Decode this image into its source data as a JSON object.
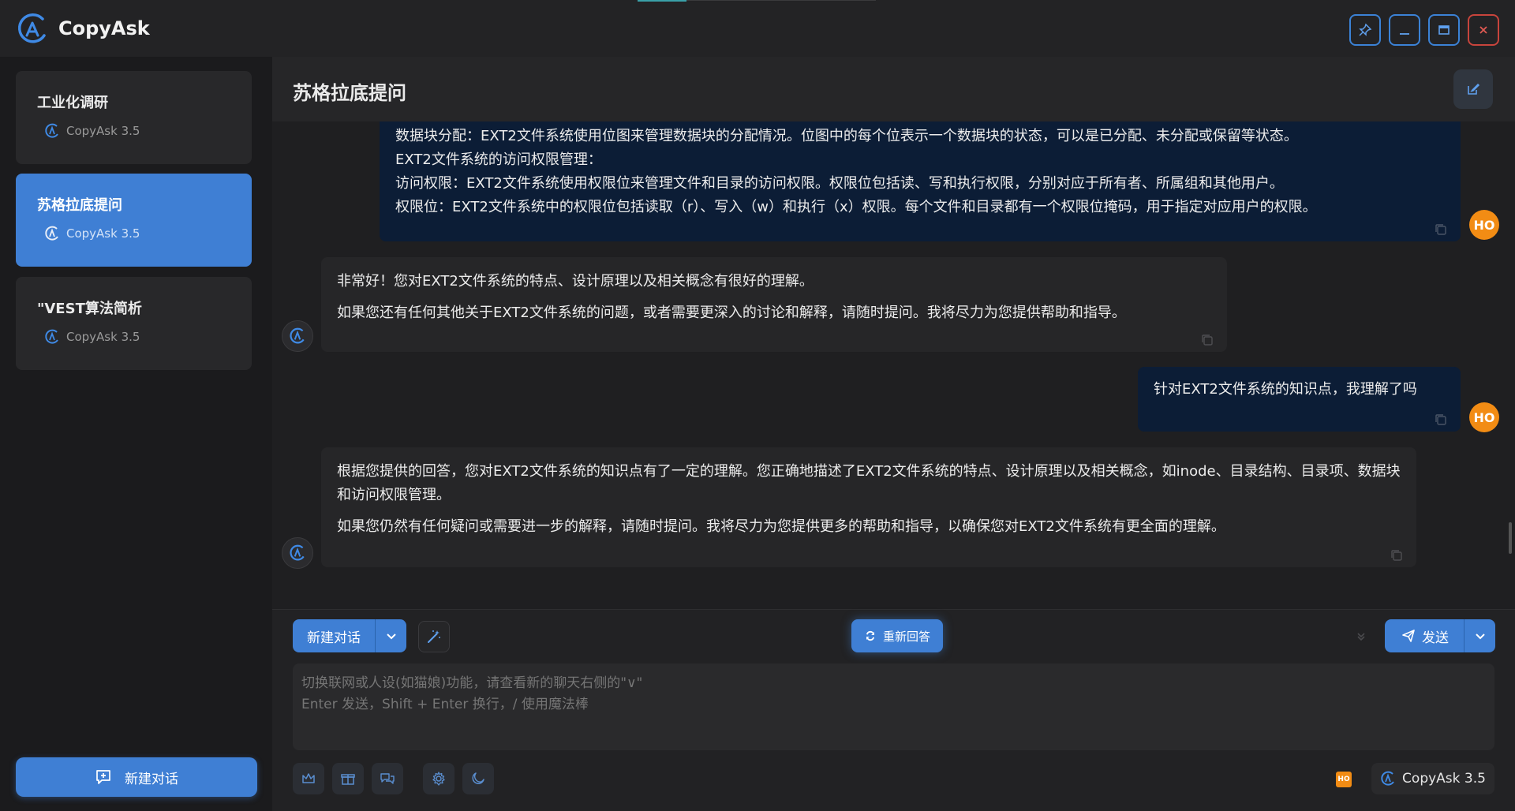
{
  "app": {
    "title": "CopyAsk"
  },
  "window_controls": {
    "pin": "pin",
    "minimize": "minimize",
    "maximize": "maximize",
    "close": "close"
  },
  "sidebar": {
    "conversations": [
      {
        "title": "工业化调研",
        "model": "CopyAsk 3.5",
        "active": false
      },
      {
        "title": "苏格拉底提问",
        "model": "CopyAsk 3.5",
        "active": true
      },
      {
        "title": "\"VEST算法简析",
        "model": "CopyAsk 3.5",
        "active": false
      }
    ],
    "new_conversation_label": "新建对话"
  },
  "chat": {
    "title": "苏格拉底提问",
    "messages": [
      {
        "role": "user",
        "avatar": "HO",
        "lines": [
          "数据块分配：EXT2文件系统使用位图来管理数据块的分配情况。位图中的每个位表示一个数据块的状态，可以是已分配、未分配或保留等状态。",
          "EXT2文件系统的访问权限管理：",
          "访问权限：EXT2文件系统使用权限位来管理文件和目录的访问权限。权限位包括读、写和执行权限，分别对应于所有者、所属组和其他用户。",
          "权限位：EXT2文件系统中的权限位包括读取（r）、写入（w）和执行（x）权限。每个文件和目录都有一个权限位掩码，用于指定对应用户的权限。"
        ]
      },
      {
        "role": "assistant",
        "lines": [
          "非常好！您对EXT2文件系统的特点、设计原理以及相关概念有很好的理解。",
          "如果您还有任何其他关于EXT2文件系统的问题，或者需要更深入的讨论和解释，请随时提问。我将尽力为您提供帮助和指导。"
        ]
      },
      {
        "role": "user",
        "avatar": "HO",
        "lines": [
          "针对EXT2文件系统的知识点，我理解了吗"
        ]
      },
      {
        "role": "assistant",
        "lines": [
          "根据您提供的回答，您对EXT2文件系统的知识点有了一定的理解。您正确地描述了EXT2文件系统的特点、设计原理以及相关概念，如inode、目录结构、目录项、数据块和访问权限管理。",
          "如果您仍然有任何疑问或需要进一步的解释，请随时提问。我将尽力为您提供更多的帮助和指导，以确保您对EXT2文件系统有更全面的理解。"
        ]
      }
    ]
  },
  "composer": {
    "new_chat_label": "新建对话",
    "regenerate_label": "重新回答",
    "send_label": "发送",
    "placeholder": "切换联网或人设(如猫娘)功能，请查看新的聊天右侧的\"∨\"\nEnter 发送，Shift + Enter 换行，/ 使用魔法棒",
    "user_badge": "HO",
    "model_label": "CopyAsk 3.5"
  },
  "colors": {
    "accent": "#3f7fd4",
    "user_bubble": "#0c1d36",
    "bot_bubble": "#262628",
    "avatar": "#f28c14",
    "close": "#c8443c"
  }
}
